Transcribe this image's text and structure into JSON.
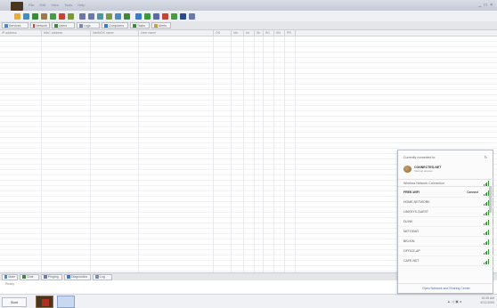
{
  "window": {
    "menu_items": [
      "File",
      "Edit",
      "View",
      "Tools",
      "Help"
    ],
    "controls": "_ □ ×"
  },
  "toolbar": {
    "icons": [
      {
        "name": "new-icon",
        "color": "#e0b040"
      },
      {
        "name": "open-icon",
        "color": "#4a88c8"
      },
      {
        "name": "save-icon",
        "color": "#3a8a3a"
      },
      {
        "name": "find-icon",
        "color": "#9a7a50"
      },
      {
        "name": "start-icon",
        "color": "#4a9a4a"
      },
      {
        "name": "stop-icon",
        "color": "#c0463a"
      },
      {
        "name": "check-icon",
        "color": "#7a9a3a"
      },
      {
        "name": "back-icon",
        "color": "#6a7aa8"
      },
      {
        "name": "forward-icon",
        "color": "#6a7aa8"
      },
      {
        "name": "refresh-icon",
        "color": "#4a9a9a"
      },
      {
        "name": "connect-icon",
        "color": "#7a9a4a"
      },
      {
        "name": "filter-icon",
        "color": "#4a8ac8"
      },
      {
        "name": "list-icon",
        "color": "#3a8a3a"
      },
      {
        "name": "grid-icon",
        "color": "#3a7ac8"
      },
      {
        "name": "chart-icon",
        "color": "#3a9a3a"
      },
      {
        "name": "monitor-icon",
        "color": "#5a6aa8"
      },
      {
        "name": "bell-icon",
        "color": "#c0463a"
      },
      {
        "name": "settings-icon",
        "color": "#4a9a4a"
      },
      {
        "name": "info-icon",
        "color": "#2a4a8a"
      },
      {
        "name": "help-icon",
        "color": "#6a7aa8"
      }
    ]
  },
  "tabs": [
    {
      "label": "Services",
      "color": "#4a88c8"
    },
    {
      "label": "Network",
      "color": "#c0463a"
    },
    {
      "label": "Users",
      "color": "#3a8a3a"
    },
    {
      "label": "Logs",
      "color": "#7a8aa8"
    },
    {
      "label": "Computers",
      "color": "#3a7ac8"
    },
    {
      "label": "Tasks",
      "color": "#3a8a3a"
    },
    {
      "label": "Alerts",
      "color": "#c8a040"
    }
  ],
  "grid": {
    "headers": [
      "IP address",
      "MAC address",
      "NetBIOS name",
      "User name",
      "OS",
      "Ver",
      "Int",
      "Sh",
      "RC",
      "SN",
      "PR"
    ]
  },
  "bottom_tabs": [
    {
      "label": "Main",
      "color": "#4a88c8"
    },
    {
      "label": "Chat",
      "color": "#3a8a3a"
    },
    {
      "label": "Pinging",
      "color": "#6a7aa8"
    },
    {
      "label": "Diagnostics",
      "color": "#3a7ac8"
    },
    {
      "label": "Log",
      "color": "#7a8aa8"
    }
  ],
  "status": {
    "text": "Ready"
  },
  "taskbar": {
    "start_label": "Start",
    "tray": "▲ ◁ ▣ ◂",
    "time": "10:45 AM",
    "date": "9/12/2009"
  },
  "wifi_flyout": {
    "header": "Currently connected to:",
    "connected_name": "CONNECTED-NET",
    "connected_status": "Internet access",
    "section_label": "Wireless Network Connection",
    "networks": [
      {
        "name": "FREE-WIFI",
        "action": "Connect"
      },
      {
        "name": "HOME-NETWORK",
        "action": ""
      },
      {
        "name": "LINKSYS-GUEST",
        "action": ""
      },
      {
        "name": "DLINK",
        "action": ""
      },
      {
        "name": "NETGEAR",
        "action": ""
      },
      {
        "name": "BELKIN",
        "action": ""
      },
      {
        "name": "OFFICE-AP",
        "action": ""
      },
      {
        "name": "CAFE-NET",
        "action": ""
      }
    ],
    "footer": "Open Network and Sharing Center"
  }
}
